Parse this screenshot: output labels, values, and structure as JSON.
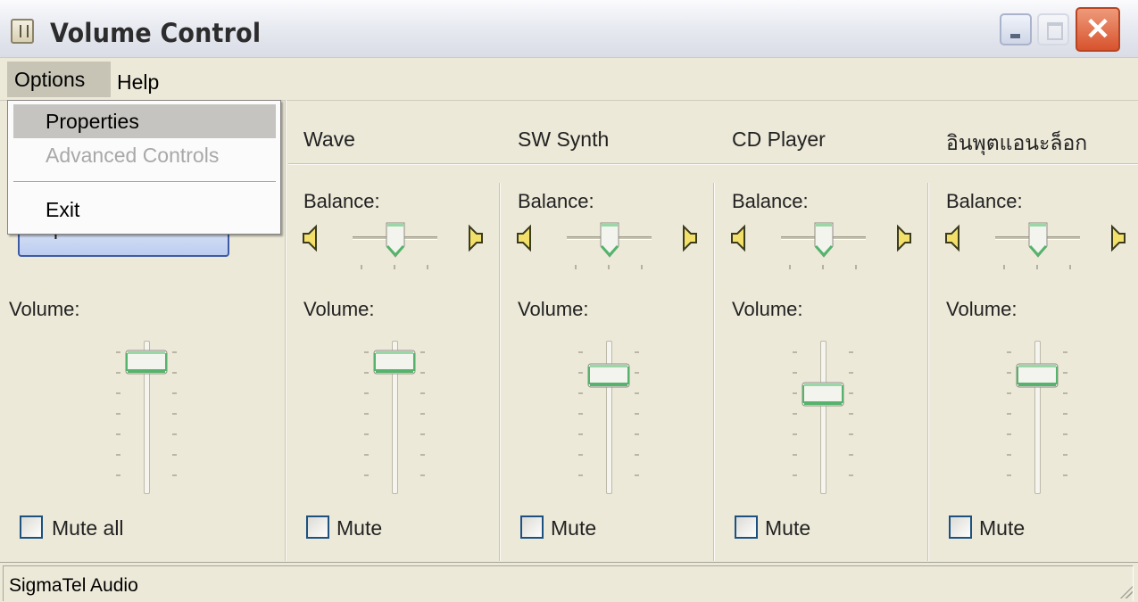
{
  "window": {
    "title": "Volume Control"
  },
  "menubar": {
    "options": "Options",
    "help": "Help"
  },
  "options_menu": {
    "items": [
      {
        "label": "Properties",
        "state": "highlighted"
      },
      {
        "label": "Advanced Controls",
        "state": "disabled"
      },
      {
        "label": "Exit",
        "state": "normal"
      }
    ]
  },
  "master": {
    "button_label": "Speaker Volume...",
    "volume_label": "Volume:",
    "mute_label": "Mute all",
    "muted": false,
    "volume_level": 0.9
  },
  "channels": [
    {
      "title": "Wave",
      "balance_label": "Balance:",
      "volume_label": "Volume:",
      "mute_label": "Mute",
      "muted": false,
      "balance": 0.5,
      "volume_level": 0.9
    },
    {
      "title": "SW Synth",
      "balance_label": "Balance:",
      "volume_label": "Volume:",
      "mute_label": "Mute",
      "muted": false,
      "balance": 0.5,
      "volume_level": 0.8
    },
    {
      "title": "CD Player",
      "balance_label": "Balance:",
      "volume_label": "Volume:",
      "mute_label": "Mute",
      "muted": false,
      "balance": 0.5,
      "volume_level": 0.65
    },
    {
      "title": "อินพุตแอนะล็อก",
      "balance_label": "Balance:",
      "volume_label": "Volume:",
      "mute_label": "Mute",
      "muted": false,
      "balance": 0.5,
      "volume_level": 0.8
    }
  ],
  "status": {
    "text": "SigmaTel Audio"
  },
  "colors": {
    "thumb_green": "#55b36b",
    "speaker_yellow": "#f2e06a",
    "close_red": "#d8532e"
  },
  "icons": {
    "app": "volume-control-app-icon",
    "left_speaker": "speaker-left-icon",
    "right_speaker": "speaker-right-icon"
  }
}
